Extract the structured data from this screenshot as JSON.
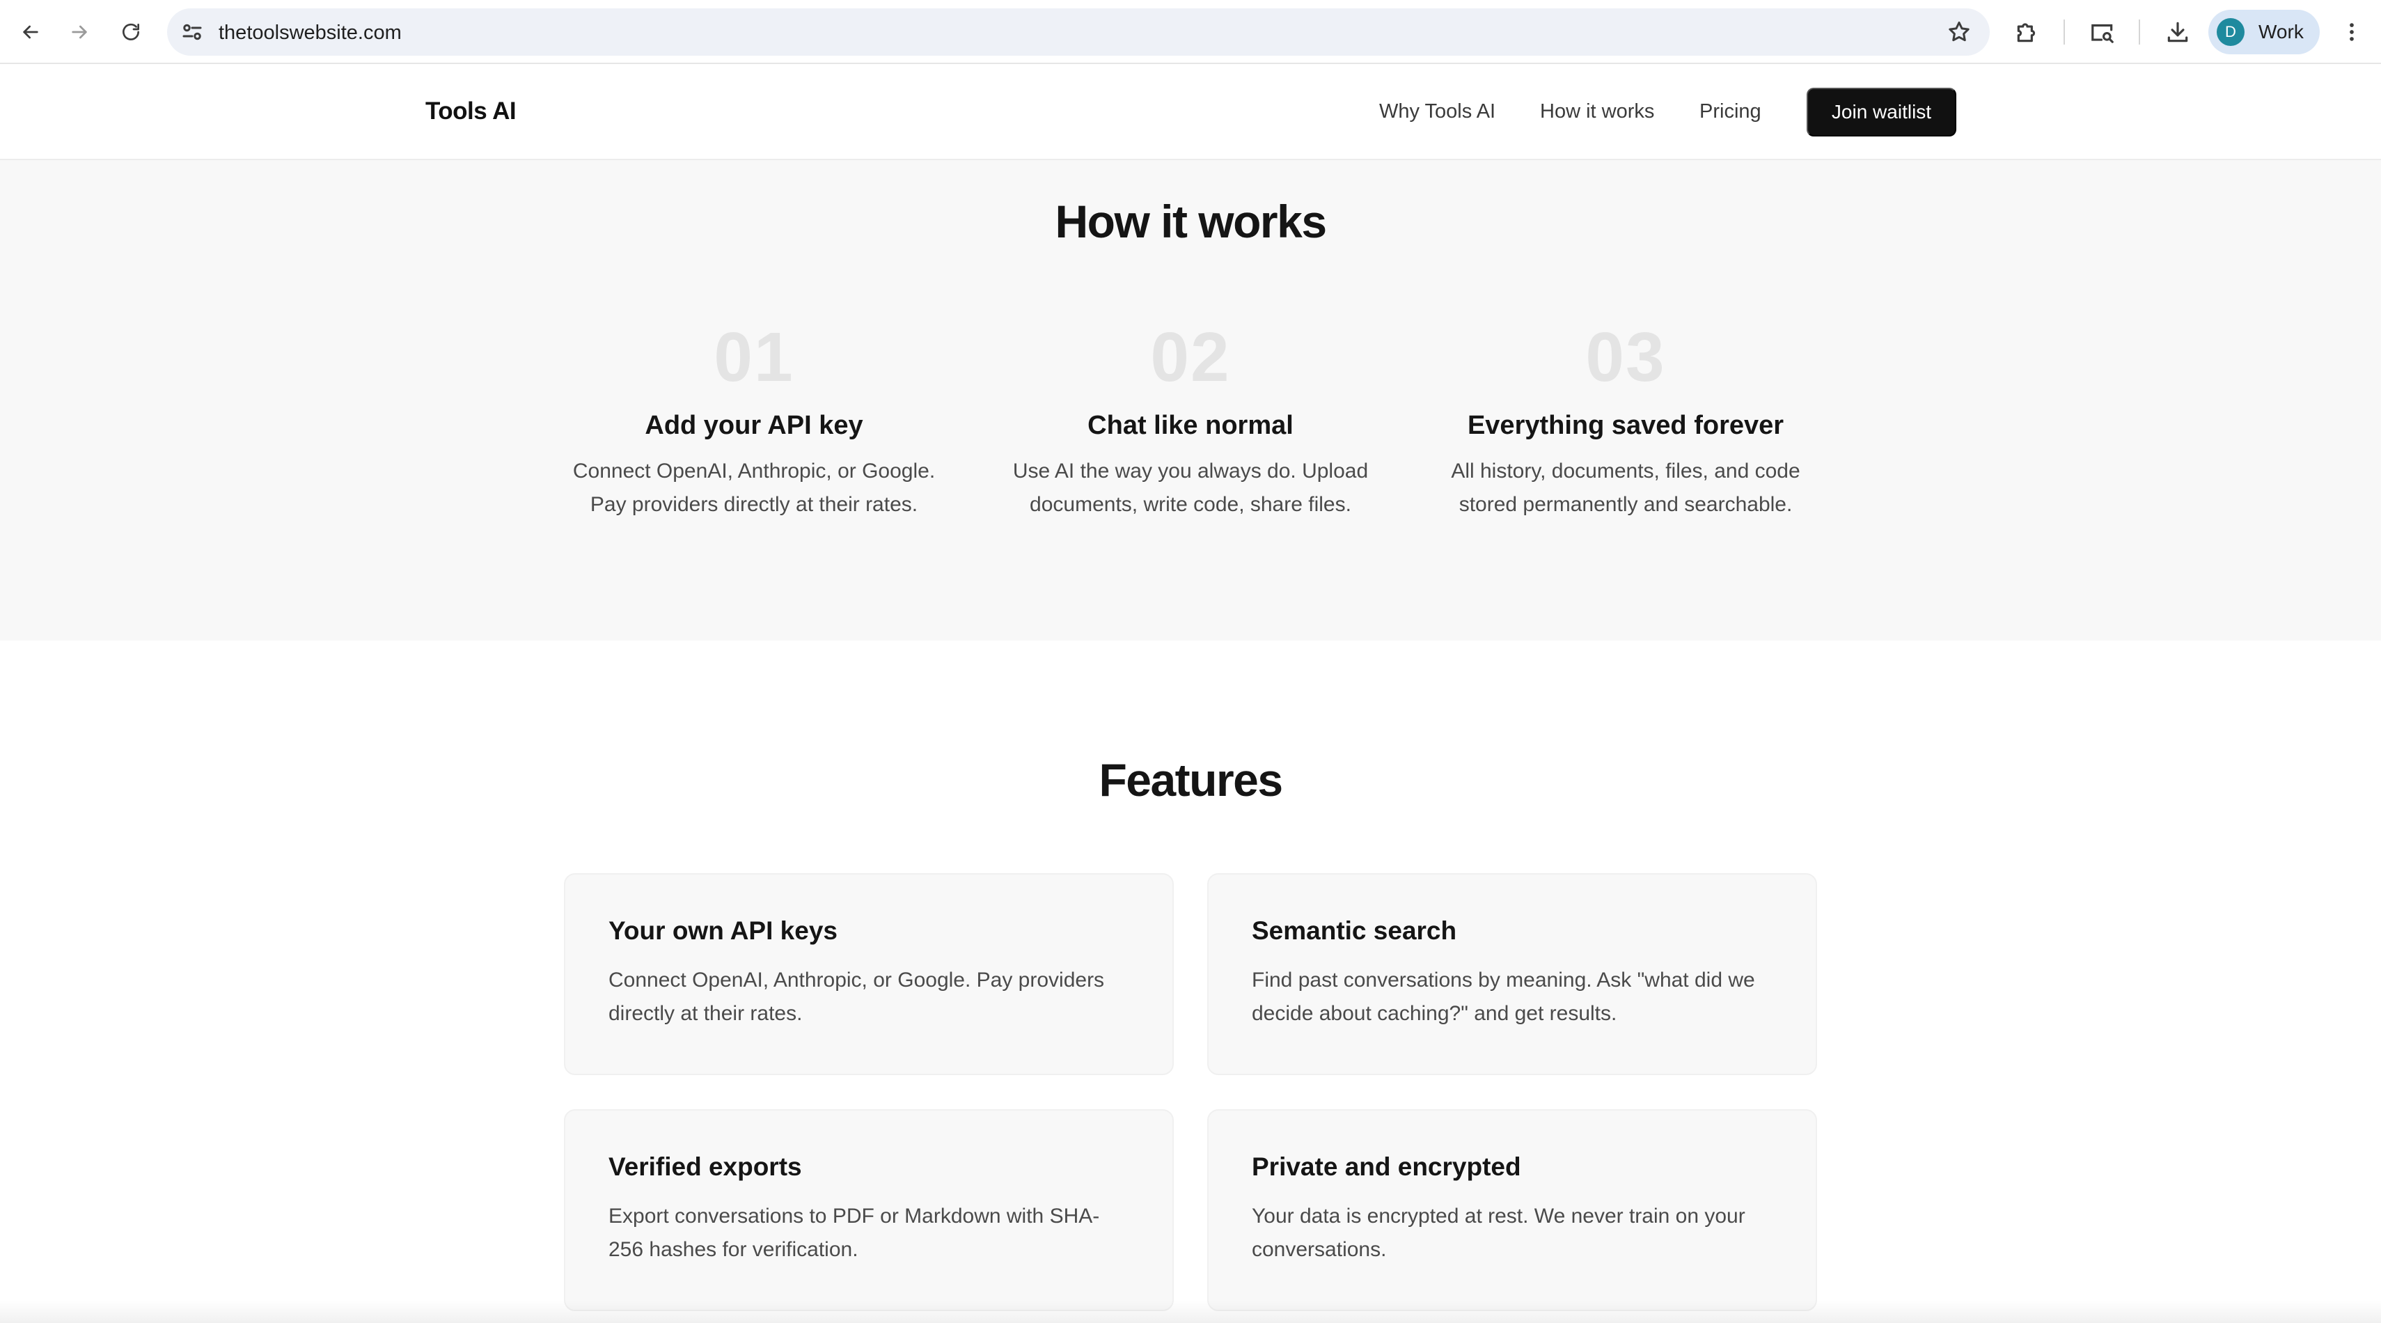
{
  "browser": {
    "url": "thetoolswebsite.com",
    "profile_initial": "D",
    "profile_name": "Work"
  },
  "site": {
    "logo": "Tools AI",
    "nav": [
      "Why Tools AI",
      "How it works",
      "Pricing"
    ],
    "cta": "Join waitlist"
  },
  "how_it_works": {
    "title": "How it works",
    "steps": [
      {
        "num": "01",
        "title": "Add your API key",
        "line1": "Connect OpenAI, Anthropic, or Google.",
        "line2": "Pay providers directly at their rates."
      },
      {
        "num": "02",
        "title": "Chat like normal",
        "line1": "Use AI the way you always do. Upload",
        "line2": "documents, write code, share files."
      },
      {
        "num": "03",
        "title": "Everything saved forever",
        "line1": "All history, documents, files, and code",
        "line2": "stored permanently and searchable."
      }
    ]
  },
  "features": {
    "title": "Features",
    "cards": [
      {
        "title": "Your own API keys",
        "line1": "Connect OpenAI, Anthropic, or Google. Pay providers",
        "line2": "directly at their rates."
      },
      {
        "title": "Semantic search",
        "line1": "Find past conversations by meaning. Ask \"what did we",
        "line2": "decide about caching?\" and get results."
      },
      {
        "title": "Verified exports",
        "line1": "Export conversations to PDF or Markdown with SHA-",
        "line2": "256 hashes for verification."
      },
      {
        "title": "Private and encrypted",
        "line1": "Your data is encrypted at rest. We never train on your",
        "line2": "conversations."
      }
    ]
  },
  "colors": {
    "cta_bg": "#111111",
    "section_bg": "#f8f8f8",
    "step_number": "#e4e4e4",
    "profile_avatar": "#1f8a9e"
  }
}
